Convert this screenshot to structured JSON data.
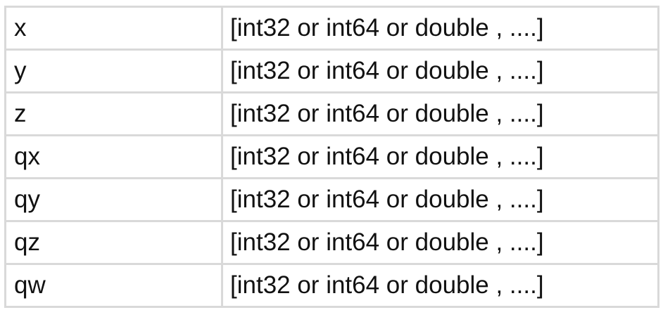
{
  "table": {
    "rows": [
      {
        "name": "x",
        "type": "[int32 or int64 or double , ....]"
      },
      {
        "name": "y",
        "type": "[int32 or int64 or double , ....]"
      },
      {
        "name": "z",
        "type": "[int32 or int64 or double , ....]"
      },
      {
        "name": "qx",
        "type": "[int32 or int64 or double , ....]"
      },
      {
        "name": "qy",
        "type": "[int32 or int64 or double , ....]"
      },
      {
        "name": "qz",
        "type": "[int32 or int64 or double , ....]"
      },
      {
        "name": "qw",
        "type": "[int32 or int64 or double , ....]"
      }
    ]
  },
  "colors": {
    "border": "#d9d9d9",
    "text": "#111111",
    "background": "#ffffff"
  }
}
